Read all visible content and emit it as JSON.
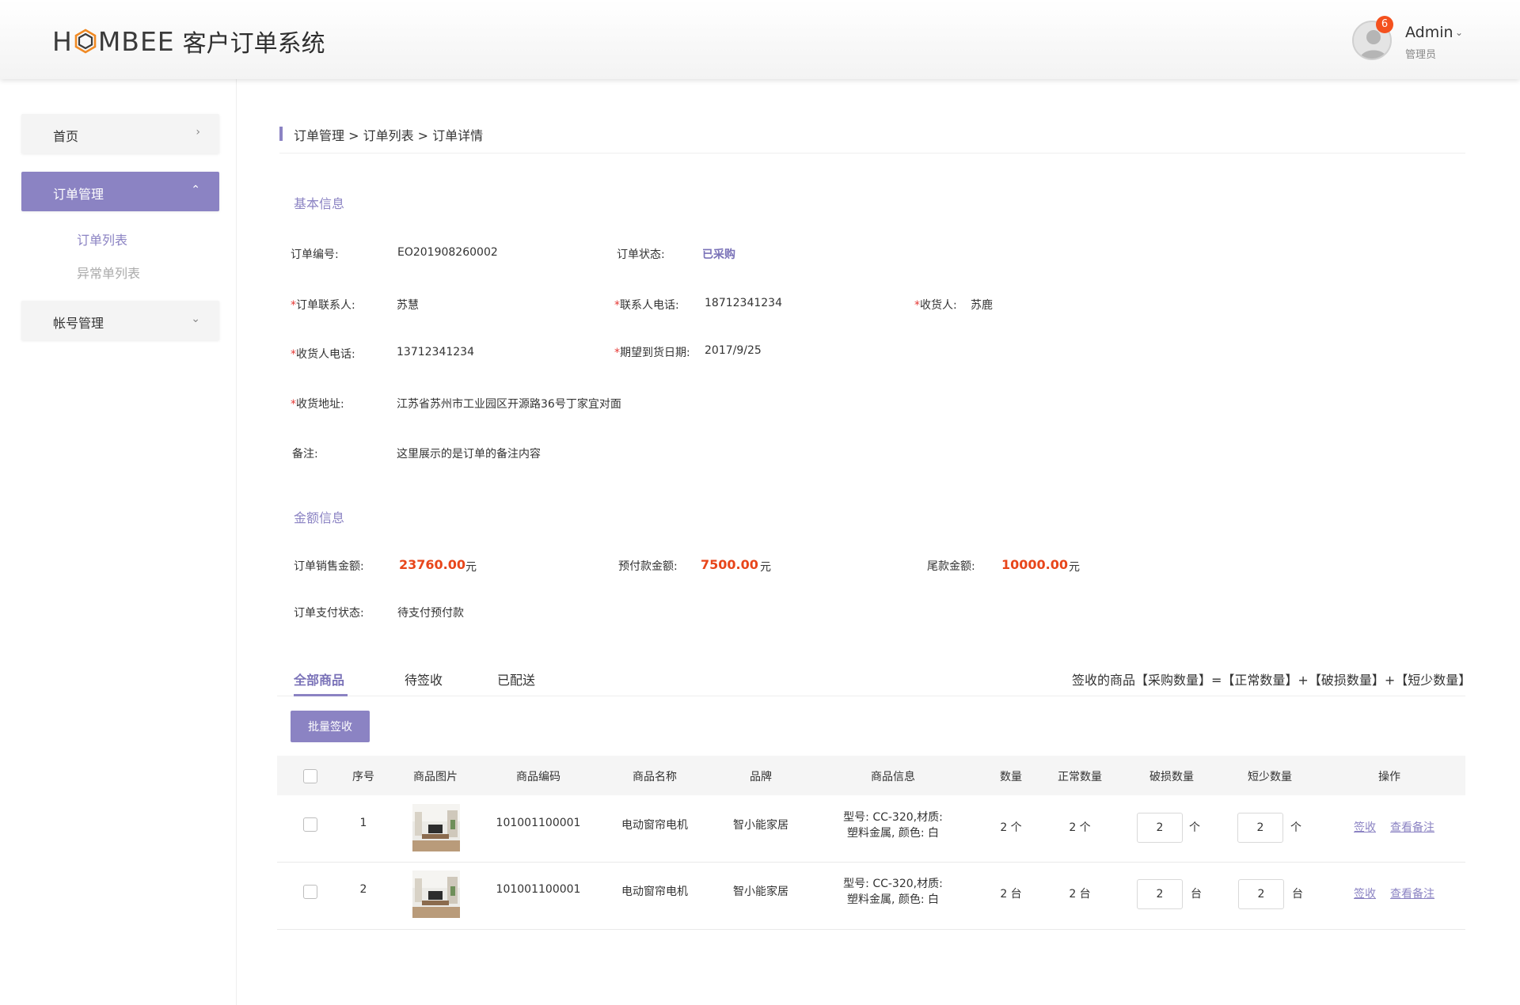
{
  "header": {
    "logo_text_left": "H",
    "logo_text_right": "MBEE",
    "system_title": "客户订单系统",
    "notification_count": "6",
    "user_name": "Admin",
    "user_role": "管理员"
  },
  "sidebar": {
    "items": [
      {
        "label": "首页"
      },
      {
        "label": "订单管理"
      },
      {
        "label": "帐号管理"
      }
    ],
    "sub_items": [
      {
        "label": "订单列表"
      },
      {
        "label": "异常单列表"
      }
    ]
  },
  "breadcrumb": "订单管理 > 订单列表 > 订单详情",
  "basic_info": {
    "title": "基本信息",
    "order_no_label": "订单编号:",
    "order_no": "EO201908260002",
    "order_status_label": "订单状态:",
    "order_status": "已采购",
    "contact_label": "订单联系人:",
    "contact": "苏慧",
    "contact_phone_label": "联系人电话:",
    "contact_phone": "18712341234",
    "receiver_label": "收货人:",
    "receiver": "苏鹿",
    "receiver_phone_label": "收货人电话:",
    "receiver_phone": "13712341234",
    "expected_date_label": "期望到货日期:",
    "expected_date": "2017/9/25",
    "address_label": "收货地址:",
    "address": "江苏省苏州市工业园区开源路36号丁家宜对面",
    "remark_label": "备注:",
    "remark": "这里展示的是订单的备注内容",
    "required_mark": "*"
  },
  "amount_info": {
    "title": "金额信息",
    "sale_label": "订单销售金额:",
    "sale_amount": "23760.00",
    "prepay_label": "预付款金额:",
    "prepay_amount": "7500.00",
    "balance_label": "尾款金额:",
    "balance_amount": "10000.00",
    "currency": "元",
    "pay_status_label": "订单支付状态:",
    "pay_status": "待支付预付款"
  },
  "tabs": [
    {
      "label": "全部商品"
    },
    {
      "label": "待签收"
    },
    {
      "label": "已配送"
    }
  ],
  "formula": "签收的商品【采购数量】=【正常数量】+【破损数量】+【短少数量】",
  "batch_button": "批量签收",
  "table": {
    "headers": [
      "序号",
      "商品图片",
      "商品编码",
      "商品名称",
      "品牌",
      "商品信息",
      "数量",
      "正常数量",
      "破损数量",
      "短少数量",
      "操作"
    ],
    "rows": [
      {
        "index": "1",
        "code": "101001100001",
        "name": "电动窗帘电机",
        "brand": "智小能家居",
        "info_line1": "型号: CC-320,材质:",
        "info_line2": "塑料金属, 颜色: 白",
        "qty": "2 个",
        "normal_qty": "2 个",
        "damaged_qty": "2",
        "damaged_unit": "个",
        "short_qty": "2",
        "short_unit": "个",
        "action_sign": "签收",
        "action_remark": "查看备注"
      },
      {
        "index": "2",
        "code": "101001100001",
        "name": "电动窗帘电机",
        "brand": "智小能家居",
        "info_line1": "型号: CC-320,材质:",
        "info_line2": "塑料金属, 颜色: 白",
        "qty": "2 台",
        "normal_qty": "2 台",
        "damaged_qty": "2",
        "damaged_unit": "台",
        "short_qty": "2",
        "short_unit": "台",
        "action_sign": "签收",
        "action_remark": "查看备注"
      }
    ]
  },
  "colors": {
    "accent": "#8b83c3",
    "amount": "#e8461b",
    "badge": "#f4511e",
    "required": "#e53935"
  }
}
